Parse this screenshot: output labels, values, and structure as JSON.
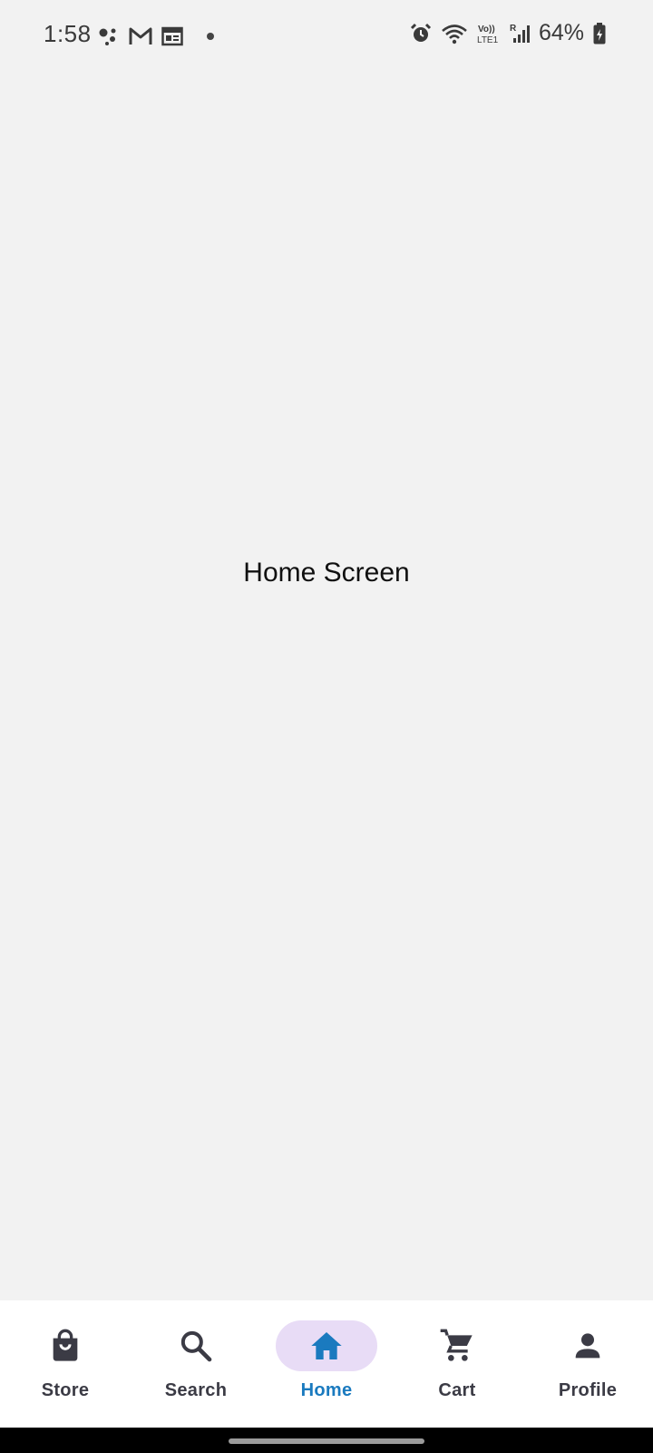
{
  "status_bar": {
    "time": "1:58",
    "battery": "64%",
    "left_icons": [
      "assistant-icon",
      "gmail-icon",
      "calendar-icon",
      "notification-dot"
    ],
    "right_icons": [
      "alarm-icon",
      "wifi-icon",
      "volte-icon",
      "signal-icon",
      "battery-icon"
    ]
  },
  "main": {
    "title": "Home Screen"
  },
  "bottom_nav": {
    "items": [
      {
        "label": "Store",
        "icon": "shopping-bag-icon"
      },
      {
        "label": "Search",
        "icon": "search-icon"
      },
      {
        "label": "Home",
        "icon": "home-icon",
        "active": true
      },
      {
        "label": "Cart",
        "icon": "cart-icon"
      },
      {
        "label": "Profile",
        "icon": "person-icon"
      }
    ]
  },
  "colors": {
    "background": "#f2f2f2",
    "nav_background": "#ffffff",
    "active_pill": "#e8dcf6",
    "active_color": "#1a7abf",
    "inactive_color": "#3b3b45"
  }
}
